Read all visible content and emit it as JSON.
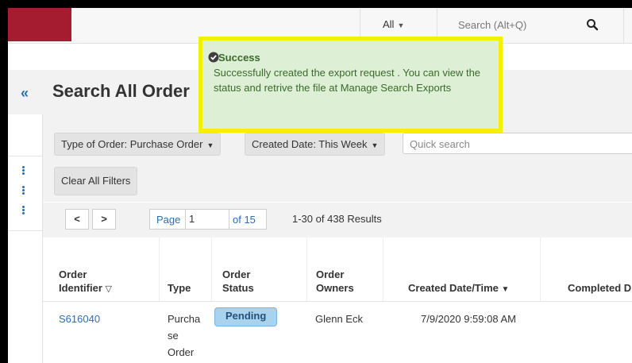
{
  "header": {
    "scope_label": "All",
    "search_placeholder": "Search (Alt+Q)",
    "colors": {
      "brand": "#a51c30",
      "accent": "#2d6eb0"
    }
  },
  "page": {
    "title": "Search All Order",
    "collapse_icon": "«"
  },
  "filters": {
    "type_of_order": "Type of Order: Purchase Order",
    "created_date": "Created Date: This Week",
    "quick_search_placeholder": "Quick search",
    "clear_all": "Clear All Filters"
  },
  "pager": {
    "prev": "<",
    "next": ">",
    "page_label": "Page",
    "page_value": "1",
    "of_label": "of 15",
    "results": "1-30 of 438 Results"
  },
  "table": {
    "columns": {
      "order_identifier": [
        "Order",
        "Identifier"
      ],
      "type": "Type",
      "order_status": [
        "Order",
        "Status"
      ],
      "order_owners": [
        "Order",
        "Owners"
      ],
      "created": "Created Date/Time",
      "completed": "Completed D"
    },
    "rows": [
      {
        "identifier": "S616040",
        "type_lines": [
          "Purcha",
          "se",
          "Order"
        ],
        "status": "Pending",
        "owner": "Glenn Eck",
        "created": "7/9/2020 9:59:08 AM"
      }
    ]
  },
  "toast": {
    "title": "Success",
    "body": "Successfully created the export request . You can view the status and retrive the file at Manage Search Exports",
    "colors": {
      "background": "#ddefd5",
      "highlight": "#f5f000"
    }
  }
}
